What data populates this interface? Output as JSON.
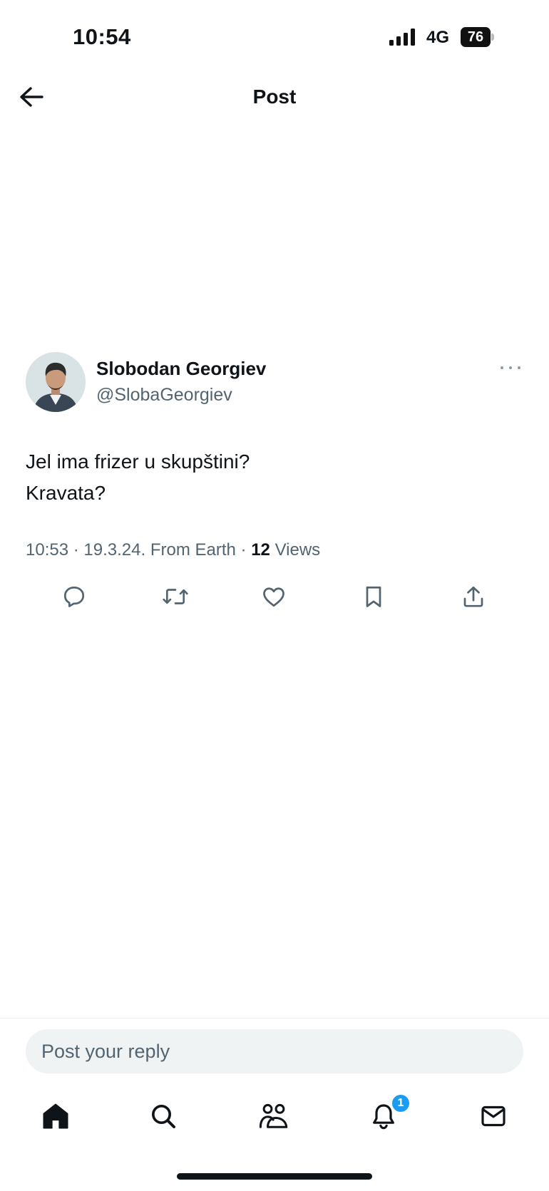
{
  "status_bar": {
    "time": "10:54",
    "network": "4G",
    "battery": "76"
  },
  "header": {
    "title": "Post"
  },
  "author": {
    "name": "Slobodan Georgiev",
    "handle": "@SlobaGeorgiev"
  },
  "tweet": {
    "lines": [
      "Jel ima frizer u skupštini?",
      "Kravata?"
    ],
    "time": "10:53",
    "date": "19.3.24.",
    "source": "From Earth",
    "views_count": "12",
    "views_label": "Views"
  },
  "actions": [
    "reply-icon",
    "retweet-icon",
    "like-icon",
    "bookmark-icon",
    "share-icon"
  ],
  "reply": {
    "placeholder": "Post your reply"
  },
  "bottom_nav": {
    "items": [
      "home-icon",
      "search-icon",
      "communities-icon",
      "notifications-icon",
      "messages-icon"
    ],
    "notification_badge": "1"
  },
  "colors": {
    "text": "#0f1419",
    "muted": "#536471",
    "accent": "#1d9bf0",
    "input_bg": "#eff3f4"
  }
}
